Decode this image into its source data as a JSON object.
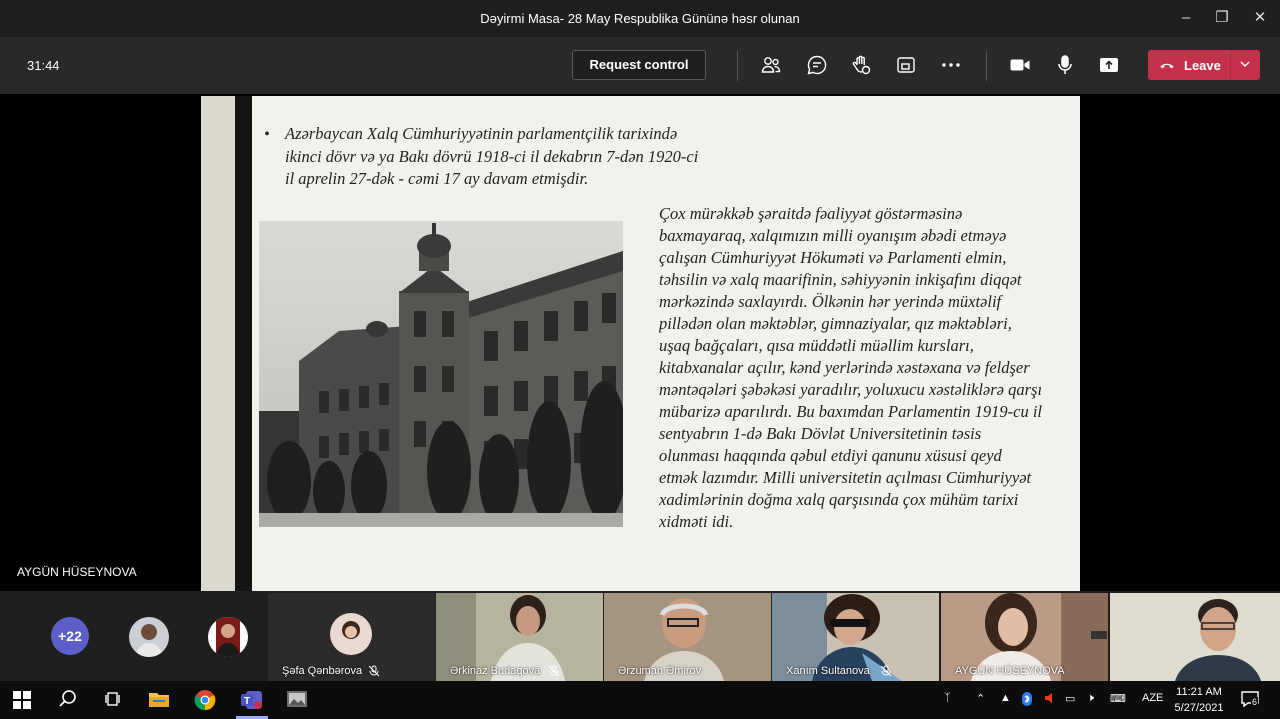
{
  "window": {
    "title": "Dəyirmi Masa- 28 May Respublika Gününə həsr olunan",
    "minimize_icon": "minimize-icon",
    "maximize_icon": "maximize-icon",
    "close_icon": "close-icon"
  },
  "toolbar": {
    "timer": "31:44",
    "request_control_label": "Request control",
    "leave_label": "Leave",
    "icons": [
      "people-icon",
      "chat-icon",
      "raise-hand-icon",
      "share-tray-icon",
      "more-icon",
      "camera-icon",
      "mic-icon",
      "share-screen-icon"
    ]
  },
  "stage": {
    "presenter_name": "AYGÜN HÜSEYNOVA",
    "slide": {
      "bullet_text": "Azərbaycan Xalq Cümhuriyyətinin parlamentçilik tarixində ikinci dövr və ya Bakı dövrü 1918-ci il dekabrın 7-dən 1920-ci il aprelin 27-dək - cəmi 17 ay davam etmişdir.",
      "body_text": "Çox mürəkkəb şəraitdə fəaliyyət göstərməsinə\nbaxmayaraq, xalqımızın milli oyanışım əbədi etməyə\nçalışan Cümhuriyyət Hökuməti və Parlamenti elmin,\ntəhsilin və xalq maarifinin, səhiyyənin inkişafını diqqət\nmərkəzində saxlayırdı. Ölkənin hər yerində müxtəlif\npillədən olan məktəblər, gimnaziyalar, qız məktəbləri,\nuşaq bağçaları, qısa müddətli müəllim kursları,\nkitabxanalar açılır, kənd yerlərində xəstəxana və feldşer\nməntəqələri şəbəkəsi yaradılır, yoluxucu xəstəliklərə qarşı\nmübarizə aparılırdı. Bu baxımdan Parlamentin 1919-cu il\nsentyabrın 1-də Bakı Dövlət Universitetinin təsis\nolunması haqqında qəbul etdiyi qanunu xüsusi qeyd\netmək lazımdır. Milli universitetin açılması Cümhuriyyət\nxadimlərinin doğma xalq qarşısında çox mühüm tarixi\nxidməti idi."
    }
  },
  "participants": {
    "overflow_count": "+22",
    "tiles": [
      {
        "name": "Şəfa Qənbərova"
      },
      {
        "name": "Ərkinaz Budaqova"
      },
      {
        "name": "Ərzuman Əmirov"
      },
      {
        "name": "Xanım Sultanova"
      },
      {
        "name": "AYGÜN HÜSEYNOVA"
      },
      {
        "name": ""
      }
    ]
  },
  "taskbar": {
    "language": "AZE",
    "time": "11:21 AM",
    "date": "5/27/2021",
    "notification_count": "6",
    "apps": [
      "windows-start-icon",
      "search-icon",
      "task-view-icon",
      "file-explorer-icon",
      "chrome-icon",
      "teams-icon",
      "image-viewer-icon"
    ]
  }
}
